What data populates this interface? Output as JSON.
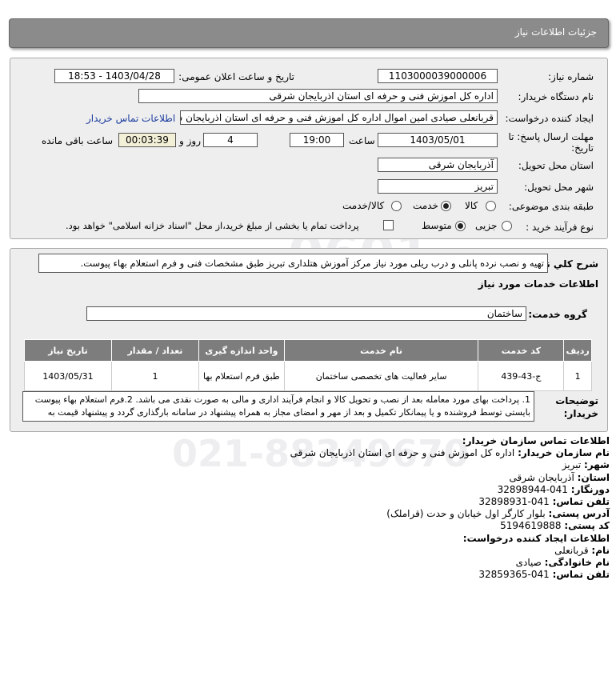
{
  "page_title": "جزئیات اطلاعات نیاز",
  "need_number": {
    "label": "شماره نیاز:",
    "value": "1103000039000006"
  },
  "announce": {
    "label": "تاریخ و ساعت اعلان عمومی:",
    "value": "1403/04/28 - 18:53"
  },
  "buyer": {
    "label": "نام دستگاه خریدار:",
    "value": "اداره کل اموزش فنی و حرفه ای استان اذربایجان شرقی"
  },
  "creator": {
    "label": "ایجاد کننده درخواست:",
    "value": "قربانعلی صیادی امین اموال اداره کل اموزش فنی و حرفه ای استان اذربایجان شرقی",
    "contact_link": "اطلاعات تماس خریدار"
  },
  "deadline": {
    "label_line1": "مهلت ارسال پاسخ: تا",
    "label_line2": "تاریخ:",
    "date": "1403/05/01",
    "time_label": "ساعت",
    "time": "19:00",
    "days": "4",
    "days_label": "روز و",
    "remaining": "00:03:39",
    "remaining_label": "ساعت باقی مانده"
  },
  "province": {
    "label": "استان محل تحویل:",
    "value": "آذربایجان شرقی"
  },
  "city": {
    "label": "شهر محل تحویل:",
    "value": "تبریز"
  },
  "category": {
    "label": "طبقه بندی موضوعی:",
    "options": [
      "کالا",
      "خدمت",
      "کالا/خدمت"
    ],
    "selected": "خدمت"
  },
  "process": {
    "label": "نوع فرآیند خرید :",
    "options": [
      "جزیی",
      "متوسط"
    ],
    "selected": "متوسط",
    "payment_text": "پرداخت تمام یا بخشی از مبلغ خرید،از محل \"اسناد خزانه اسلامی\" خواهد بود."
  },
  "description": {
    "label": "شرح کلي نياز:",
    "value": "تهیه و نصب نرده پانلی و درب ریلی مورد نیاز مرکز آموزش هتلداری تبریز طبق مشخصات فنی و فرم استعلام بهاء پیوست."
  },
  "services": {
    "section_title": "اطلاعات خدمات مورد نیاز",
    "group_label": "گروه خدمت:",
    "group_value": "ساختمان",
    "columns": [
      "ردیف",
      "کد خدمت",
      "نام خدمت",
      "واحد اندازه گیری",
      "تعداد / مقدار",
      "تاریخ نیاز"
    ],
    "rows": [
      {
        "row": "1",
        "code": "ج-43-439",
        "name": "سایر فعالیت های تخصصی ساختمان",
        "unit": "طبق فرم استعلام بها",
        "qty": "1",
        "date": "1403/05/31"
      }
    ]
  },
  "notes": {
    "label_line1": "توضیحات",
    "label_line2": "خریدار:",
    "value": "1. پرداخت بهای مورد معامله بعد از نصب و تحویل کالا و انجام فرآیند اداری و مالی به صورت نقدی می باشد. 2.فرم استعلام بهاء پیوست بایستی توسط فروشنده و یا پیمانکار تکمیل و بعد از مهر و امضای مجاز به همراه پیشنهاد در سامانه بارگذاری گردد و پیشنهاد قیمت به صورت کل بوده و به صورت ماه به ماه به خریدار ارسال شود."
  },
  "buyer_contact": {
    "title": "اطلاعات تماس سازمان خریدار:",
    "org_label": "نام سازمان خریدار:",
    "org": "اداره کل اموزش فنی و حرفه ای استان اذربایجان شرقی",
    "city_label": "شهر:",
    "city": "تبریز",
    "province_label": "استان:",
    "province": "آذربایجان شرقی",
    "fax_label": "دورنگار:",
    "fax": "041-32898944",
    "phone_label": "تلفن تماس:",
    "phone": "041-32898931",
    "address_label": "آدرس پستی:",
    "address": "بلوار کارگر اول خیابان و حدت (قراملک)",
    "postal_label": "کد پستی:",
    "postal": "5194619888"
  },
  "creator_contact": {
    "title": "اطلاعات ایجاد کننده درخواست:",
    "first_label": "نام:",
    "first": "قربانعلی",
    "last_label": "نام خانوادگی:",
    "last": "صیادی",
    "phone_label": "تلفن تماس:",
    "phone": "041-32859365"
  }
}
